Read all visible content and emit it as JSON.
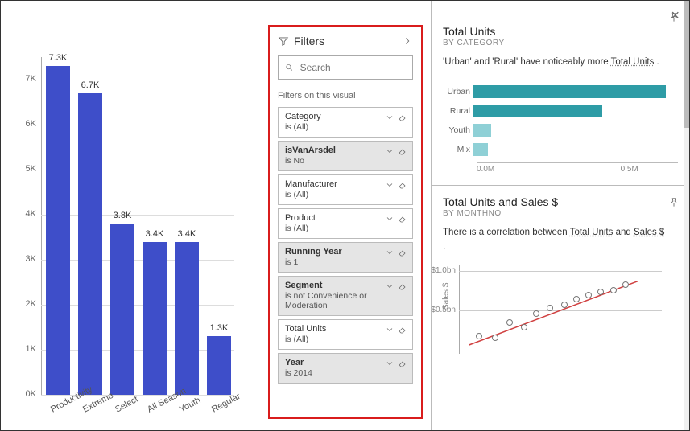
{
  "chart_data": [
    {
      "type": "bar",
      "name": "main_bar",
      "categories": [
        "Productivity",
        "Extreme",
        "Select",
        "All Season",
        "Youth",
        "Regular"
      ],
      "values": [
        7300,
        6700,
        3800,
        3400,
        3400,
        1300
      ],
      "value_labels": [
        "7.3K",
        "6.7K",
        "3.8K",
        "3.4K",
        "3.4K",
        "1.3K"
      ],
      "yticks": [
        "0K",
        "1K",
        "2K",
        "3K",
        "4K",
        "5K",
        "6K",
        "7K"
      ],
      "ylim": [
        0,
        7500
      ]
    },
    {
      "type": "bar",
      "name": "total_units_by_category",
      "orientation": "horizontal",
      "categories": [
        "Urban",
        "Rural",
        "Youth",
        "Mix"
      ],
      "values": [
        660000,
        440000,
        60000,
        50000
      ],
      "xticks": [
        "0.0M",
        "0.5M"
      ],
      "xlim": [
        0,
        700000
      ]
    },
    {
      "type": "scatter",
      "name": "units_vs_sales",
      "yticks": [
        "$0.5bn",
        "$1.0bn"
      ],
      "ylabel": "Sales $",
      "points": [
        {
          "x": 0.1,
          "y": 0.2
        },
        {
          "x": 0.18,
          "y": 0.18
        },
        {
          "x": 0.25,
          "y": 0.35
        },
        {
          "x": 0.32,
          "y": 0.3
        },
        {
          "x": 0.38,
          "y": 0.45
        },
        {
          "x": 0.45,
          "y": 0.52
        },
        {
          "x": 0.52,
          "y": 0.55
        },
        {
          "x": 0.58,
          "y": 0.62
        },
        {
          "x": 0.64,
          "y": 0.66
        },
        {
          "x": 0.7,
          "y": 0.7
        },
        {
          "x": 0.76,
          "y": 0.72
        },
        {
          "x": 0.82,
          "y": 0.78
        }
      ],
      "trendline": {
        "x0": 0.05,
        "y0": 0.1,
        "x1": 0.88,
        "y1": 0.82
      }
    }
  ],
  "filters": {
    "title": "Filters",
    "search_placeholder": "Search",
    "section_label": "Filters on this visual",
    "items": [
      {
        "name": "Category",
        "value": "is (All)",
        "active": false
      },
      {
        "name": "isVanArsdel",
        "value": "is No",
        "active": true
      },
      {
        "name": "Manufacturer",
        "value": "is (All)",
        "active": false
      },
      {
        "name": "Product",
        "value": "is (All)",
        "active": false
      },
      {
        "name": "Running Year",
        "value": "is 1",
        "active": true
      },
      {
        "name": "Segment",
        "value": "is not Convenience or Moderation",
        "active": true
      },
      {
        "name": "Total Units",
        "value": "is (All)",
        "active": false
      },
      {
        "name": "Year",
        "value": "is 2014",
        "active": true
      }
    ]
  },
  "insights": {
    "card1": {
      "title": "Total Units",
      "subtitle": "BY CATEGORY",
      "desc_pre": "'Urban' and 'Rural' have noticeably more ",
      "desc_link": "Total Units",
      "desc_post": " ."
    },
    "card2": {
      "title": "Total Units and Sales $",
      "subtitle": "BY MONTHNO",
      "desc_pre": "There is a correlation between ",
      "desc_link1": "Total Units",
      "desc_mid": " and ",
      "desc_link2": "Sales $",
      "desc_post": " ."
    }
  }
}
